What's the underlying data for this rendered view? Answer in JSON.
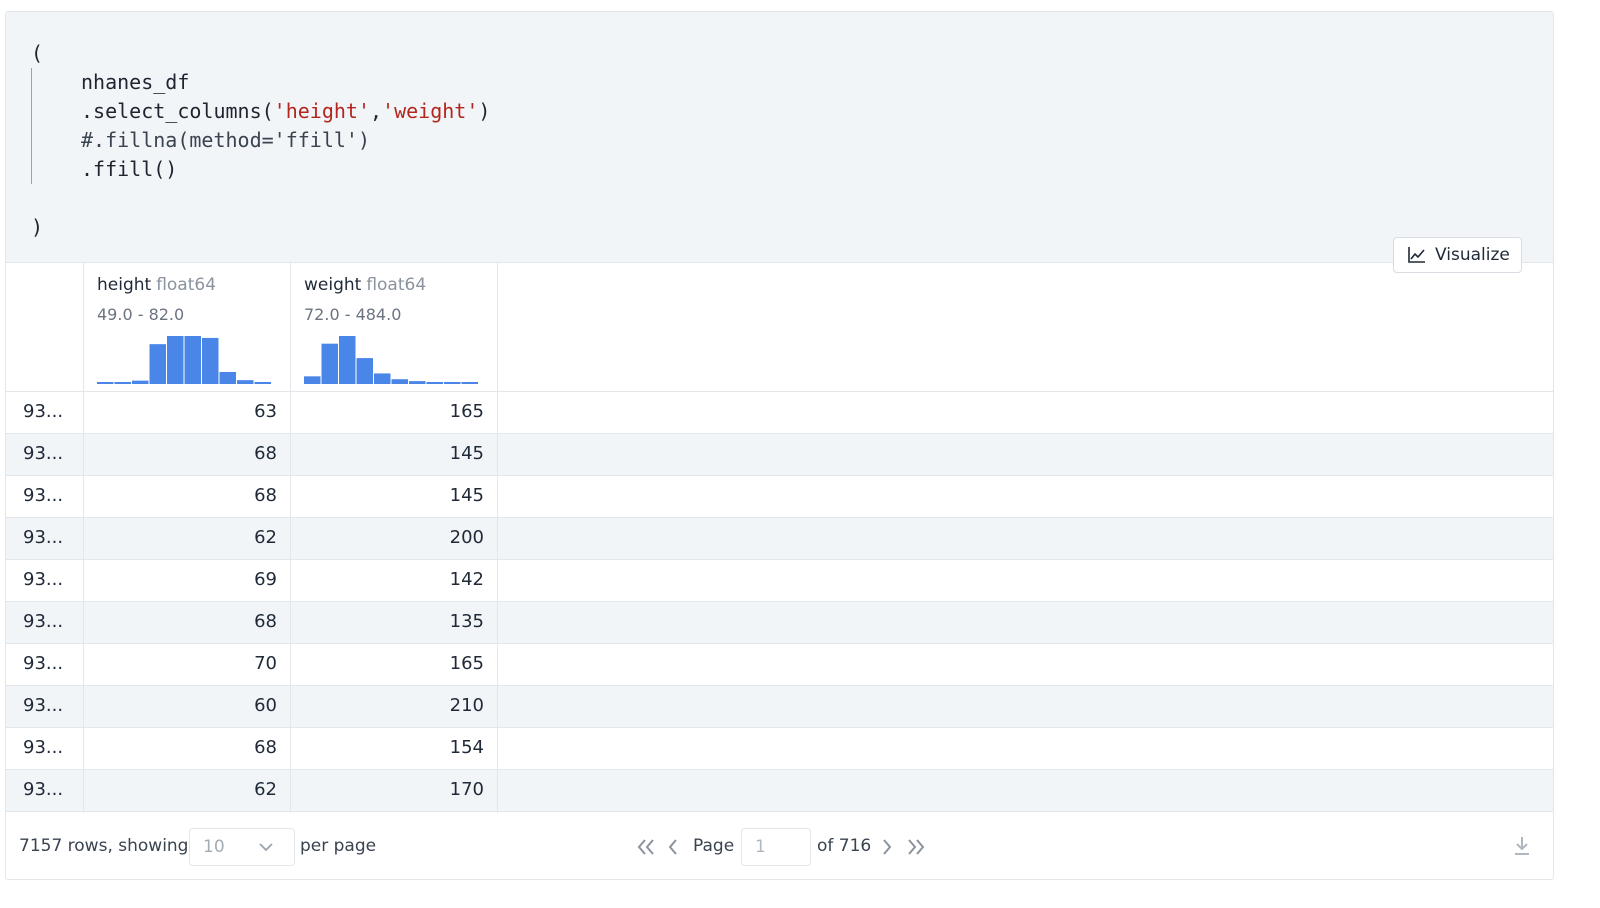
{
  "code": {
    "lines": [
      "(",
      "nhanes_df",
      ".select_columns(",
      "#.fillna(method='ffill')",
      ".ffill()",
      ")"
    ],
    "str_height": "'height'",
    "comma": ",",
    "str_weight": "'weight'",
    "close_paren": ")"
  },
  "visualize_label": "Visualize",
  "columns": [
    {
      "name": "height",
      "dtype": "float64",
      "range": "49.0 - 82.0",
      "hist": [
        0.04,
        0.04,
        0.07,
        0.83,
        1.0,
        1.0,
        0.96,
        0.25,
        0.08,
        0.03
      ]
    },
    {
      "name": "weight",
      "dtype": "float64",
      "range": "72.0 - 484.0",
      "hist": [
        0.16,
        0.84,
        1.0,
        0.54,
        0.22,
        0.1,
        0.06,
        0.03,
        0.03,
        0.02
      ]
    }
  ],
  "rows": [
    {
      "index": "93...",
      "height": "63",
      "weight": "165"
    },
    {
      "index": "93...",
      "height": "68",
      "weight": "145"
    },
    {
      "index": "93...",
      "height": "68",
      "weight": "145"
    },
    {
      "index": "93...",
      "height": "62",
      "weight": "200"
    },
    {
      "index": "93...",
      "height": "69",
      "weight": "142"
    },
    {
      "index": "93...",
      "height": "68",
      "weight": "135"
    },
    {
      "index": "93...",
      "height": "70",
      "weight": "165"
    },
    {
      "index": "93...",
      "height": "60",
      "weight": "210"
    },
    {
      "index": "93...",
      "height": "68",
      "weight": "154"
    },
    {
      "index": "93...",
      "height": "62",
      "weight": "170"
    }
  ],
  "footer": {
    "rows_text": "7157 rows, showing",
    "page_size": "10",
    "per_page": "per page",
    "page_label": "Page",
    "page_input_placeholder": "1",
    "of_text": "of 716"
  },
  "colors": {
    "bar": "#4a86e8",
    "code_bg": "#f2f5f8",
    "string": "#b3261e"
  }
}
